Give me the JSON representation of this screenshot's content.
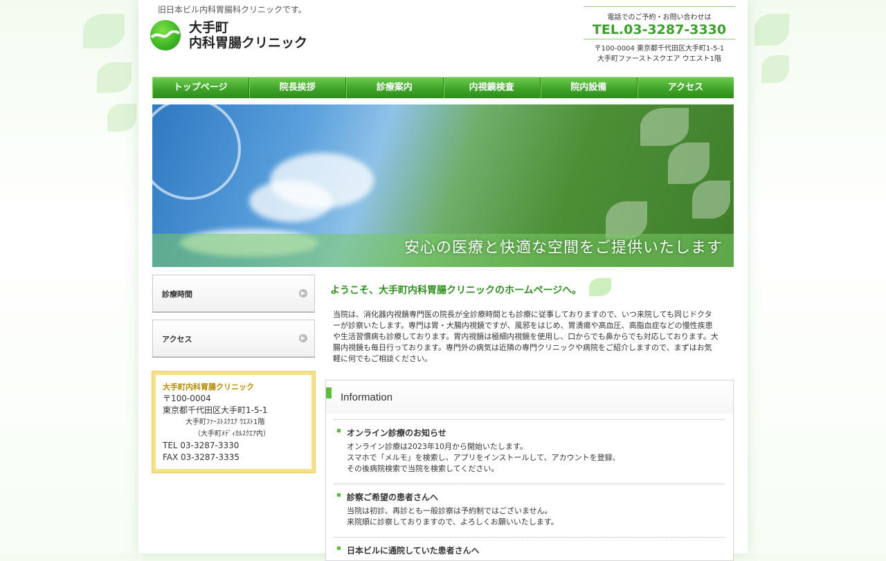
{
  "header": {
    "tagline": "旧日本ビル内科胃腸科クリニックです。",
    "logo_line1": "大手町",
    "logo_line2": "内科胃腸クリニック"
  },
  "contact": {
    "label": "電話でのご予約・お問い合わせは",
    "tel": "TEL.03-3287-3330",
    "address_line1": "〒100-0004 東京都千代田区大手町1-5-1",
    "address_line2": "大手町ファーストスクエア ウエスト1階"
  },
  "nav": {
    "items": [
      "トップページ",
      "院長挨拶",
      "診療案内",
      "内視鏡検査",
      "院内設備",
      "アクセス"
    ]
  },
  "hero": {
    "caption": "安心の医療と快適な空間をご提供いたします"
  },
  "sidebar": {
    "buttons": [
      "診療時間",
      "アクセス"
    ],
    "info": {
      "name": "大手町内科胃腸クリニック",
      "zip": "〒100-0004",
      "address": "東京都千代田区大手町1-5-1",
      "building": "大手町ﾌｧｰｽﾄｽｸｴｱ ｳｴｽﾄ1階",
      "note": "（大手町ﾒﾃﾞｨｶﾙｽｸｴｱ内）",
      "tel": "TEL 03-3287-3330",
      "fax": "FAX 03-3287-3335"
    }
  },
  "main": {
    "welcome": "ようこそ、大手町内科胃腸クリニックのホームページへ。",
    "intro_lines": [
      "当院は、消化器内視鏡専門医の院長が全診療時間とも診療に従事しておりますので、いつ来院しても同じドクタ",
      "ーが診察いたします。専門は胃・大腸内視鏡ですが、風邪をはじめ、胃潰瘍や高血圧、高脂血症などの慢性疾患",
      "や生活習慣病も診療しております。胃内視鏡は極細内視鏡を使用し、口からでも鼻からでも対応しております。大",
      "腸内視鏡も毎日行っております。専門外の病気は近隣の専門クリニックや病院をご紹介しますので、まずはお気",
      "軽に何でもご相談ください。"
    ],
    "info_title": "Information",
    "news": [
      {
        "title": "オンライン診療のお知らせ",
        "lines": [
          "オンライン診療は2023年10月から開始いたします。",
          "スマホで「メルモ」を検索し、アプリをインストールして、アカウントを登録、",
          "その後病院検索で当院を検索してください。"
        ]
      },
      {
        "title": "診察ご希望の患者さんへ",
        "lines": [
          "当院は初診、再診とも一般診察は予約制ではございません。",
          "来院順に診察しておりますので、よろしくお願いいたします。"
        ]
      },
      {
        "title": "日本ビルに通院していた患者さんへ",
        "lines": []
      }
    ]
  }
}
